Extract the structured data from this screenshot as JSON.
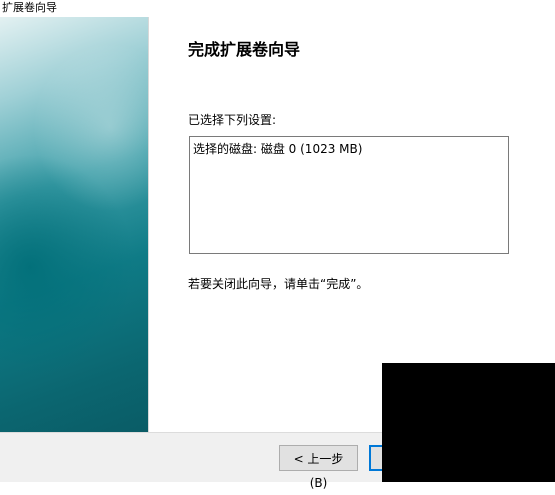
{
  "window": {
    "title": "扩展卷向导"
  },
  "wizard": {
    "heading": "完成扩展卷向导",
    "settings_label": "已选择下列设置:",
    "settings": [
      "选择的磁盘: 磁盘 0 (1023 MB)"
    ],
    "close_hint": "若要关闭此向导，请单击“完成”。"
  },
  "buttons": {
    "back": "< 上一步(B)",
    "finish": ""
  },
  "colors": {
    "accent_border": "#0078d7",
    "panel_teal": "#0f7b86"
  }
}
